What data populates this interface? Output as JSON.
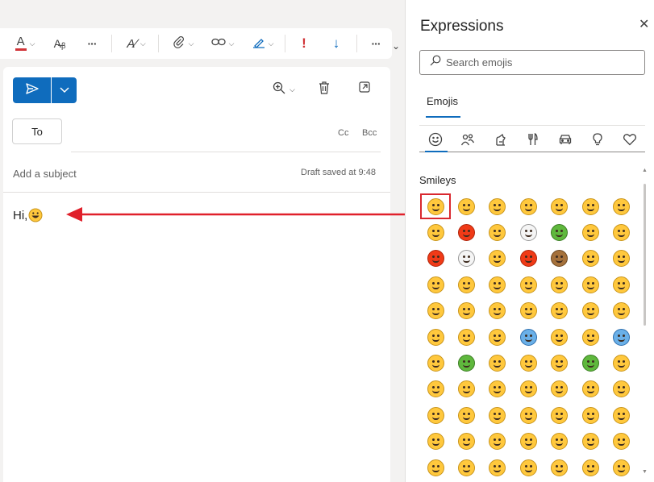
{
  "toolbar": {
    "more_label": "···",
    "overflow_chevron": "⌄",
    "icons": [
      "font-color-icon",
      "clear-format-icon",
      "more-options-icon",
      "editor-icon",
      "attach-icon",
      "link-icon",
      "signature-icon",
      "importance-high-icon",
      "importance-low-icon",
      "more-options-icon"
    ]
  },
  "compose": {
    "to_label": "To",
    "cc_label": "Cc",
    "bcc_label": "Bcc",
    "subject_placeholder": "Add a subject",
    "draft_status": "Draft saved at 9:48",
    "body_text": "Hi,"
  },
  "expressions": {
    "title": "Expressions",
    "close_label": "✕",
    "search_placeholder": "Search emojis",
    "tab_label": "Emojis",
    "categories": [
      "smileys-icon",
      "people-icon",
      "animals-icon",
      "food-icon",
      "travel-icon",
      "objects-icon",
      "symbols-icon"
    ],
    "section_label": "Smileys",
    "emoji_rows": 11,
    "emoji_cols": 7
  },
  "colors": {
    "accent": "#0f6cbd",
    "highlight_red": "#d9282f",
    "emoji_yellow": "#ffc83d"
  }
}
